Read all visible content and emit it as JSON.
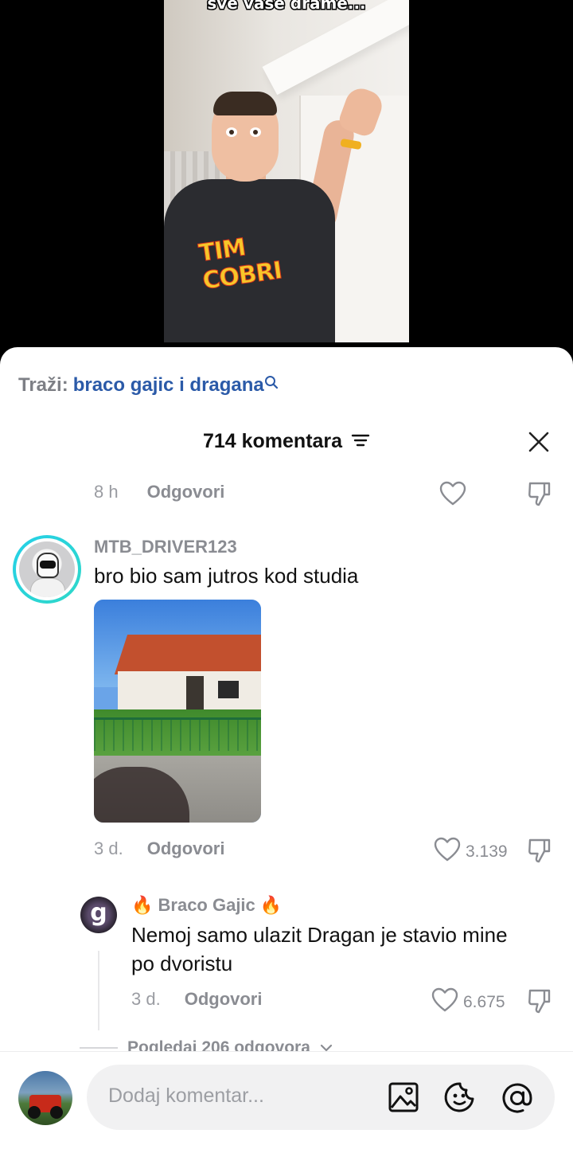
{
  "video": {
    "caption": "sve vase drame...",
    "shirt_text": "TIM COBRI"
  },
  "search": {
    "prefix": "Traži:",
    "query": "braco gajic i dragana",
    "icon": "search-icon"
  },
  "header": {
    "title": "714 komentara",
    "filter_icon": "filter-icon",
    "close_icon": "close-icon"
  },
  "comments": [
    {
      "time": "8 h",
      "reply_label": "Odgovori",
      "like_count": ""
    },
    {
      "username": "MTB_DRIVER123",
      "text": "bro bio sam jutros kod studia",
      "time": "3 d.",
      "reply_label": "Odgovori",
      "like_count": "3.139"
    }
  ],
  "reply": {
    "username": "🔥 Braco Gajic 🔥",
    "text": "Nemoj samo ulazit Dragan je stavio mine po dvoristu",
    "time": "3 d.",
    "reply_label": "Odgovori",
    "like_count": "6.675",
    "avatar_letter": "g"
  },
  "view_more": "Pogledaj 206 odgovora",
  "composer": {
    "placeholder": "Dodaj komentar...",
    "icons": [
      "image-icon",
      "emoji-icon",
      "mention-icon"
    ]
  },
  "colors": {
    "link_blue": "#2b5aa8",
    "muted": "#8a8c92",
    "avatar_ring": "#25d0e8"
  }
}
